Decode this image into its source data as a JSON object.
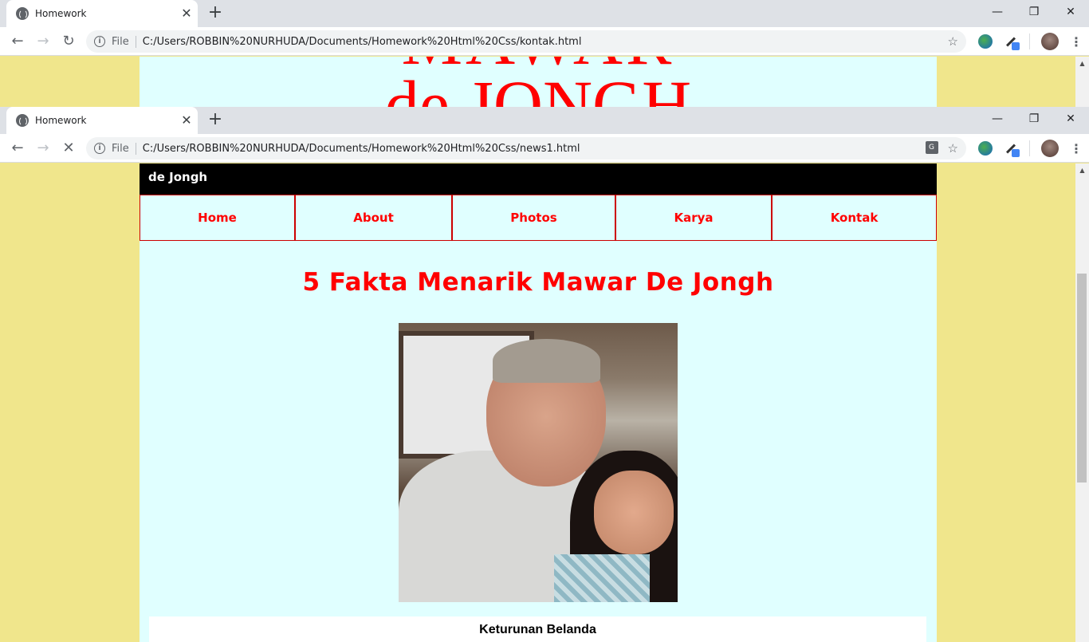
{
  "back_window": {
    "tab_title": "Homework",
    "file_label": "File",
    "url": "C:/Users/ROBBIN%20NURHUDA/Documents/Homework%20Html%20Css/kontak.html",
    "title_line1": "MAWAR",
    "title_line2": "de JONGH"
  },
  "front_window": {
    "tab_title": "Homework",
    "file_label": "File",
    "url": "C:/Users/ROBBIN%20NURHUDA/Documents/Homework%20Html%20Css/news1.html"
  },
  "browser": {
    "close_glyph": "✕",
    "new_tab_glyph": "+",
    "minimize_glyph": "—",
    "restore_glyph": "❐",
    "close_window_glyph": "✕",
    "back_glyph": "←",
    "forward_glyph": "→",
    "reload_glyph": "↻",
    "stop_glyph": "✕",
    "star_glyph": "☆",
    "menu_glyph": "⋮",
    "info_glyph": "i",
    "translate_glyph": "G",
    "scroll_up_glyph": "▲"
  },
  "page": {
    "header_title": "de Jongh",
    "nav": [
      "Home",
      "About",
      "Photos",
      "Karya",
      "Kontak"
    ],
    "article_title": "5 Fakta Menarik Mawar De Jongh",
    "section_heading": "Keturunan Belanda",
    "section_text": ""
  },
  "colors": {
    "page_background": "#f0e68c",
    "content_background": "#e0ffff",
    "accent": "#ff0000",
    "header_background": "#000000"
  }
}
